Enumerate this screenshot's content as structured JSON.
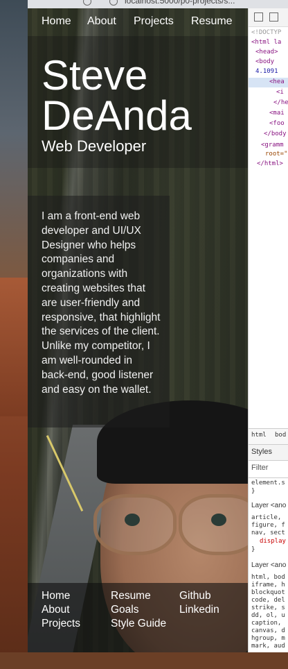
{
  "browser": {
    "url_fragment": "localhost:5000/p0-projects/s..."
  },
  "nav": {
    "items": [
      "Home",
      "About",
      "Projects",
      "Resume"
    ]
  },
  "hero": {
    "name_line1": "Steve",
    "name_line2": "DeAnda",
    "subtitle": "Web Developer"
  },
  "about": {
    "text": "I am a front-end web developer and UI/UX Designer who helps companies and organizations with creating websites that are user-friendly and responsive, that highlight the services of the client. Unlike my competitor, I am well-rounded in back-end, good listener and easy on the wallet."
  },
  "footer": {
    "col1": [
      "Home",
      "About",
      "Projects"
    ],
    "col2": [
      "Resume",
      "Goals",
      "Style Guide"
    ],
    "col3": [
      "Github",
      "Linkedin"
    ]
  },
  "devtools": {
    "elements": [
      "<!DOCTYP",
      "<html la",
      "<head>",
      "<body",
      "4.1091",
      "<hea",
      "<i",
      "</he",
      "<mai",
      "<foo",
      "</body",
      "<gramm",
      "root=\"",
      "</html>"
    ],
    "breadcrumb": [
      "html",
      "bod"
    ],
    "tabs": [
      "Styles"
    ],
    "filter_label": "Filter",
    "rules": [
      "element.s",
      "}",
      "Layer <ano",
      "article,",
      "figure, f",
      "nav, sect",
      "display",
      "}",
      "Layer <ano",
      "html, bod",
      "iframe, h",
      "blockquot",
      "code, del",
      "strike, s",
      "dd, ol, u",
      "caption,",
      "canvas, d",
      "hgroup, m",
      "mark, aud"
    ]
  }
}
